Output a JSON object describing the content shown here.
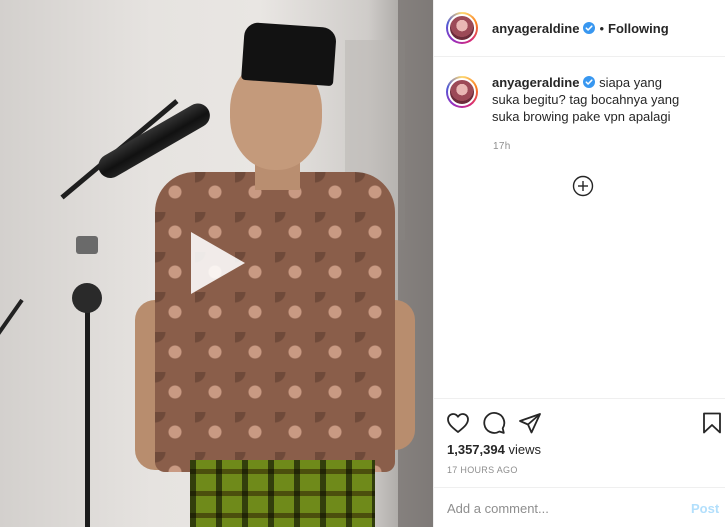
{
  "header": {
    "username": "anyageraldine",
    "separator": "•",
    "follow_status": "Following"
  },
  "caption": {
    "username": "anyageraldine",
    "text": "siapa yang suka begitu? tag bocahnya yang suka browing pake vpn apalagi",
    "time": "17h"
  },
  "stats": {
    "views_count": "1,357,394",
    "views_label": "views",
    "posted_ago": "17 HOURS AGO"
  },
  "comment": {
    "placeholder": "Add a comment...",
    "post_label": "Post"
  },
  "colors": {
    "verified_blue": "#3897f0",
    "post_button_disabled": "#b2dffc",
    "meta_gray": "#8e8e8e",
    "text_dark": "#262626"
  },
  "icons": {
    "media": "play-icon",
    "verified": "verified-badge-icon",
    "load_more": "plus-circle-icon",
    "like": "heart-icon",
    "comment": "comment-bubble-icon",
    "share": "paper-plane-icon",
    "save": "bookmark-icon"
  }
}
